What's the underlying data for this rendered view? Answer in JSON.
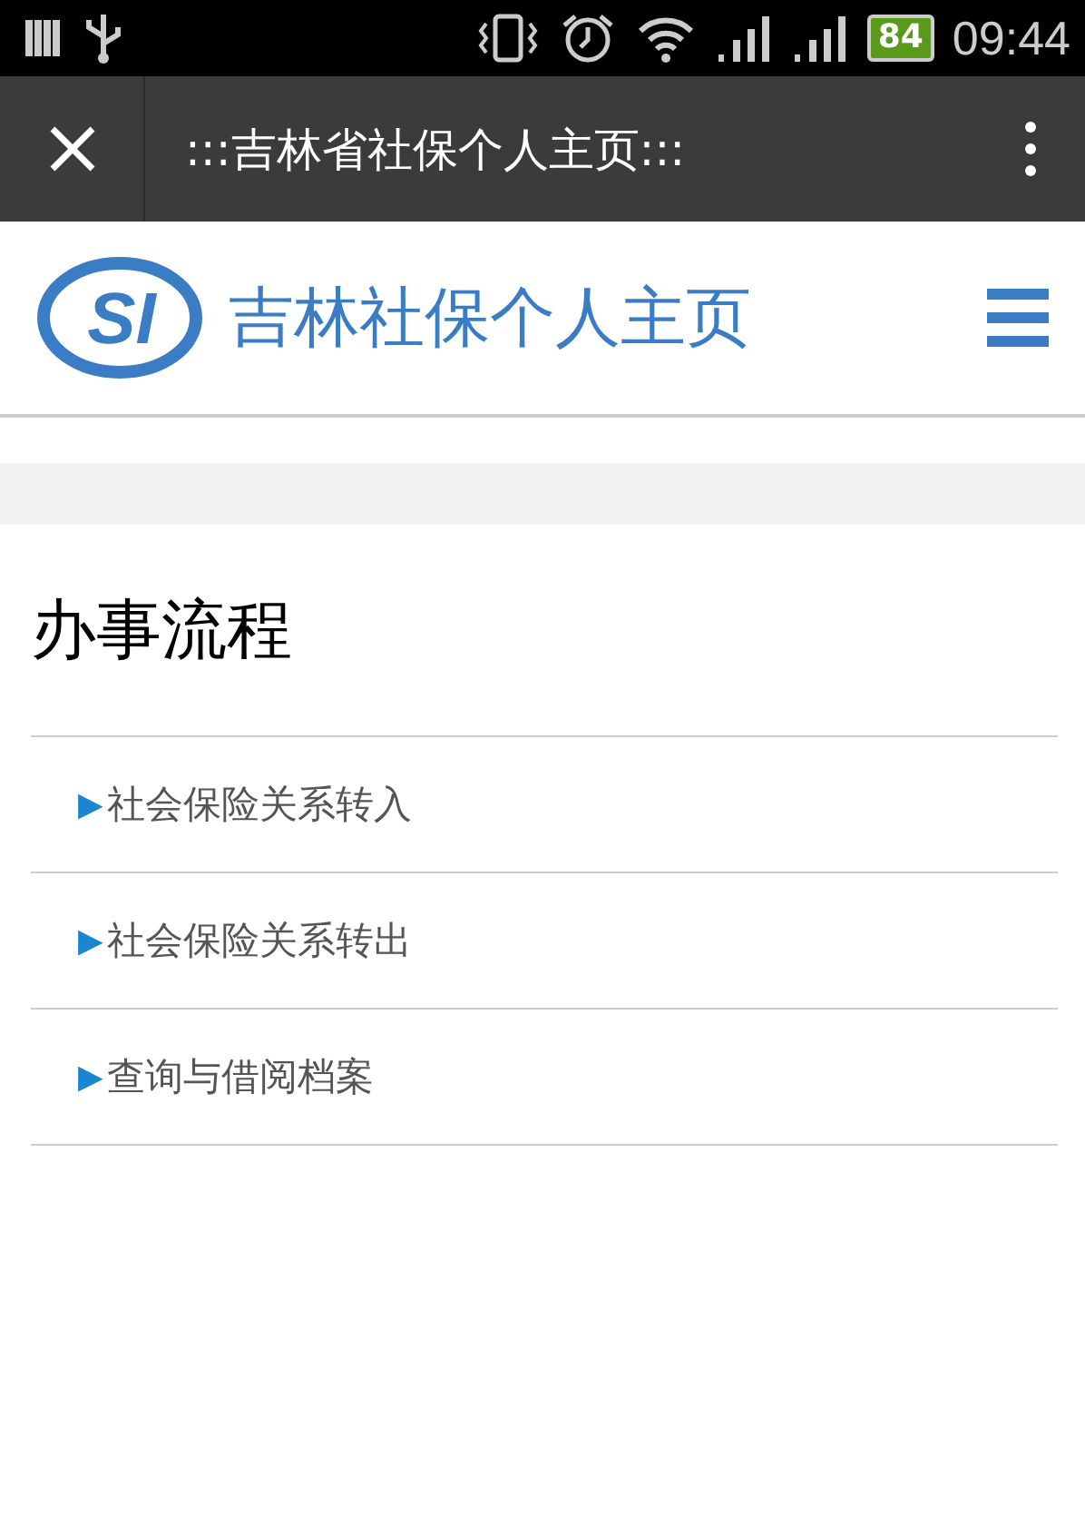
{
  "status_bar": {
    "battery": "84",
    "time": "09:44"
  },
  "browser_bar": {
    "title": ":::吉林省社保个人主页:::"
  },
  "header": {
    "logo_letters": "SI",
    "site_name": "吉林社保个人主页"
  },
  "section": {
    "title": "办事流程",
    "items": [
      {
        "marker": "▶",
        "label": "社会保险关系转入"
      },
      {
        "marker": "▶",
        "label": "社会保险关系转出"
      },
      {
        "marker": "▶",
        "label": "查询与借阅档案"
      }
    ]
  }
}
